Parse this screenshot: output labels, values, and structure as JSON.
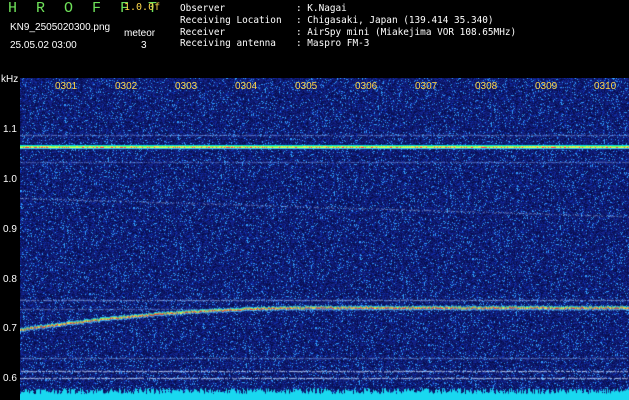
{
  "header": {
    "brand": "H R O F F T",
    "version": "1.0.0f",
    "filename": "KN9_2505020300.png",
    "datetime": "25.05.02 03:00",
    "meteor_label": "meteor",
    "meteor_count": "3"
  },
  "info": [
    {
      "label": "Observer",
      "value": ": K.Nagai"
    },
    {
      "label": "Receiving Location",
      "value": ": Chigasaki, Japan (139.414 35.340)"
    },
    {
      "label": "Receiver",
      "value": ": AirSpy mini (Miakejima VOR 108.65MHz)"
    },
    {
      "label": "Receiving antenna",
      "value": ": Maspro FM-3"
    }
  ],
  "axis": {
    "y_unit": "kHz",
    "y_ticks": [
      "1.1",
      "1.0",
      "0.9",
      "0.8",
      "0.7",
      "0.6"
    ],
    "x_ticks": [
      "0301",
      "0302",
      "0303",
      "0304",
      "0305",
      "0306",
      "0307",
      "0308",
      "0309",
      "0310"
    ]
  },
  "colors": {
    "background": "#000000",
    "noise": "#1a2fa0",
    "signal": "#ff3a2a",
    "brand": "#6fe35a",
    "accent": "#ffd84a"
  }
}
